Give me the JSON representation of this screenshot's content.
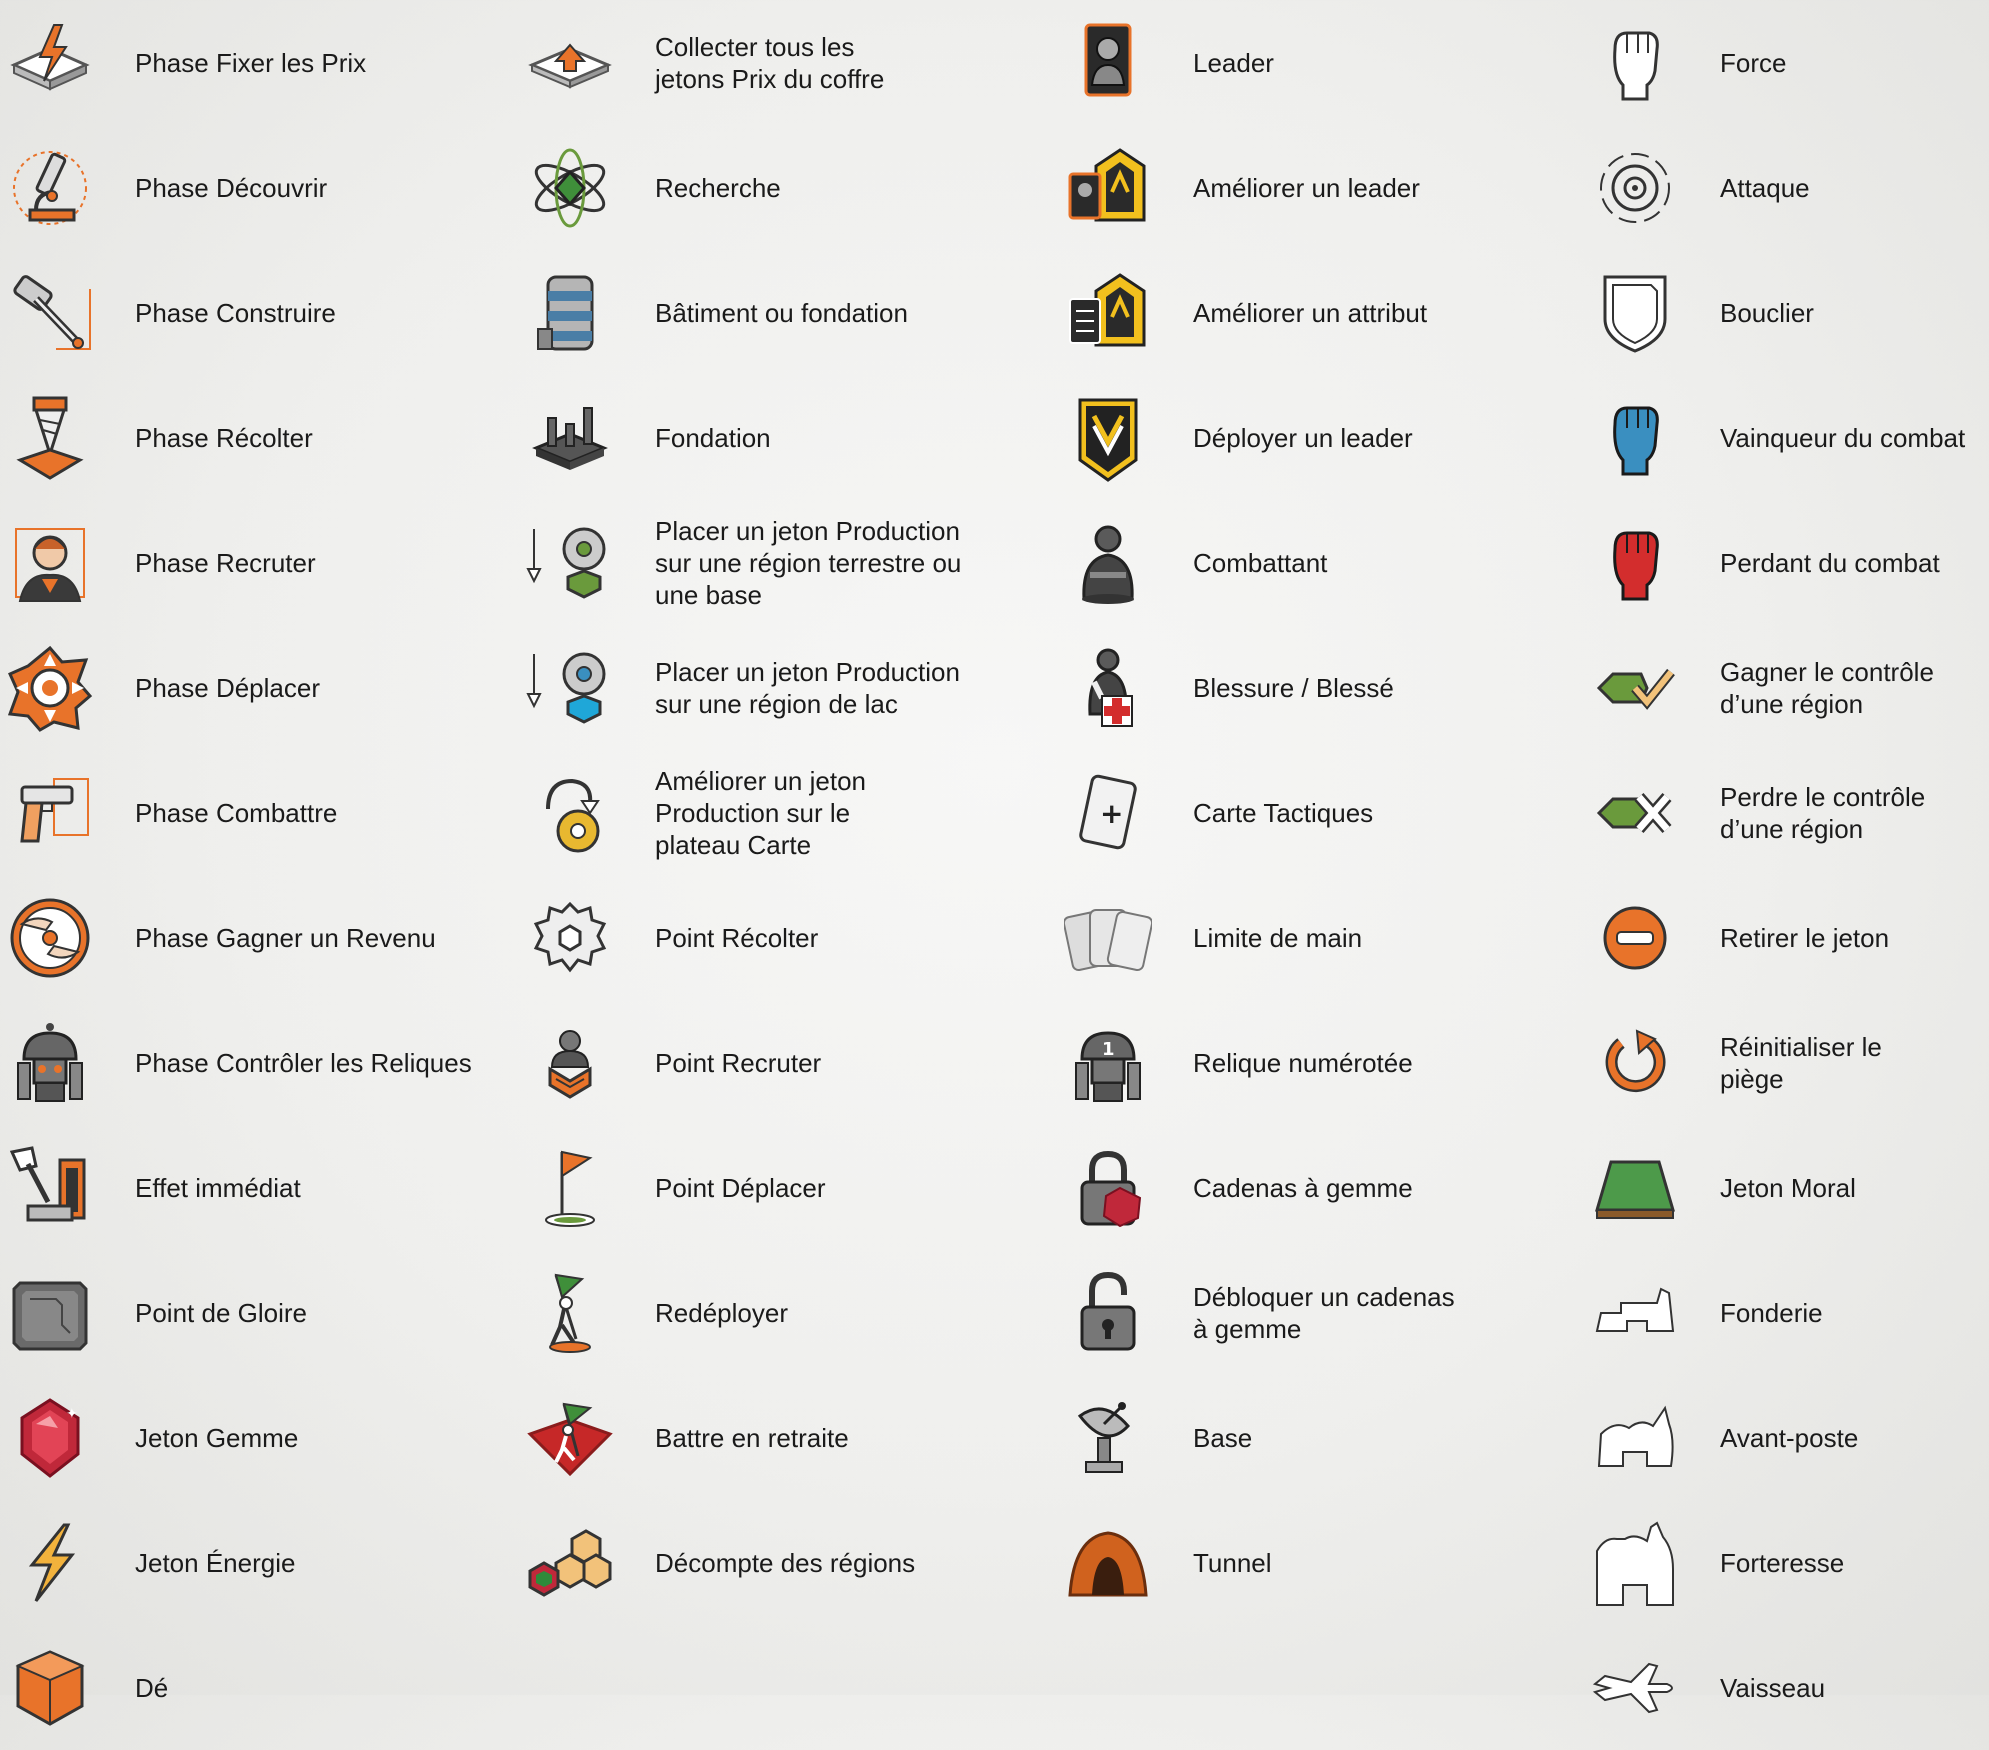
{
  "columns": [
    {
      "items": [
        {
          "label": "Phase Fixer les Prix",
          "icon": "price-phase-icon"
        },
        {
          "label": "Phase Découvrir",
          "icon": "microscope-icon"
        },
        {
          "label": "Phase Construire",
          "icon": "hammer-icon"
        },
        {
          "label": "Phase Récolter",
          "icon": "drill-icon"
        },
        {
          "label": "Phase Recruter",
          "icon": "recruit-portrait-icon"
        },
        {
          "label": "Phase Déplacer",
          "icon": "move-arrows-icon"
        },
        {
          "label": "Phase Combattre",
          "icon": "gun-icon"
        },
        {
          "label": "Phase Gagner un Revenu",
          "icon": "income-hands-icon"
        },
        {
          "label": "Phase Contrôler les Reliques",
          "icon": "relic-robot-icon"
        },
        {
          "label": "Effet immédiat",
          "icon": "lever-icon"
        },
        {
          "label": "Point de Gloire",
          "icon": "glory-chip-icon"
        },
        {
          "label": "Jeton Gemme",
          "icon": "gem-icon"
        },
        {
          "label": "Jeton Énergie",
          "icon": "energy-bolt-icon"
        },
        {
          "label": "Dé",
          "icon": "die-icon"
        }
      ]
    },
    {
      "items": [
        {
          "label": "Collecter tous les\njetons Prix du coffre",
          "icon": "collect-arrow-icon"
        },
        {
          "label": "Recherche",
          "icon": "atom-icon"
        },
        {
          "label": "Bâtiment ou fondation",
          "icon": "building-icon"
        },
        {
          "label": "Fondation",
          "icon": "foundation-icon"
        },
        {
          "label": "Placer un jeton Production\nsur une région terrestre ou\nune base",
          "icon": "production-green-icon"
        },
        {
          "label": "Placer un jeton Production\nsur une région de lac",
          "icon": "production-blue-icon"
        },
        {
          "label": "Améliorer un jeton\nProduction sur le\nplateau Carte",
          "icon": "upgrade-production-icon"
        },
        {
          "label": "Point Récolter",
          "icon": "gear-icon"
        },
        {
          "label": "Point Recruter",
          "icon": "recruit-point-icon"
        },
        {
          "label": "Point Déplacer",
          "icon": "flag-icon"
        },
        {
          "label": "Redéployer",
          "icon": "redeploy-icon"
        },
        {
          "label": "Battre en retraite",
          "icon": "retreat-icon"
        },
        {
          "label": "Décompte des régions",
          "icon": "hex-regions-icon"
        }
      ]
    },
    {
      "items": [
        {
          "label": "Leader",
          "icon": "leader-card-icon"
        },
        {
          "label": "Améliorer un leader",
          "icon": "upgrade-leader-icon"
        },
        {
          "label": "Améliorer un attribut",
          "icon": "upgrade-attribute-icon"
        },
        {
          "label": "Déployer un leader",
          "icon": "deploy-leader-icon"
        },
        {
          "label": "Combattant",
          "icon": "fighter-icon"
        },
        {
          "label": "Blessure / Blessé",
          "icon": "wounded-icon"
        },
        {
          "label": "Carte Tactiques",
          "icon": "tactics-card-icon"
        },
        {
          "label": "Limite de main",
          "icon": "hand-limit-icon"
        },
        {
          "label": "Relique numérotée",
          "icon": "numbered-relic-icon"
        },
        {
          "label": "Cadenas à gemme",
          "icon": "gem-lock-icon"
        },
        {
          "label": "Débloquer un cadenas\nà gemme",
          "icon": "unlock-icon"
        },
        {
          "label": "Base",
          "icon": "satellite-dish-icon"
        },
        {
          "label": "Tunnel",
          "icon": "tunnel-icon"
        }
      ]
    },
    {
      "items": [
        {
          "label": "Force",
          "icon": "fist-outline-icon"
        },
        {
          "label": "Attaque",
          "icon": "target-icon"
        },
        {
          "label": "Bouclier",
          "icon": "shield-icon"
        },
        {
          "label": "Vainqueur du combat",
          "icon": "blue-fist-icon"
        },
        {
          "label": "Perdant du combat",
          "icon": "red-fist-icon"
        },
        {
          "label": "Gagner le contrôle\nd’une région",
          "icon": "gain-control-icon"
        },
        {
          "label": "Perdre le contrôle\nd’une région",
          "icon": "lose-control-icon"
        },
        {
          "label": "Retirer le jeton",
          "icon": "remove-token-icon"
        },
        {
          "label": "Réinitialiser le\npiège",
          "icon": "reset-trap-icon"
        },
        {
          "label": "Jeton Moral",
          "icon": "morale-token-icon"
        },
        {
          "label": "Fonderie",
          "icon": "foundry-icon"
        },
        {
          "label": "Avant-poste",
          "icon": "outpost-icon"
        },
        {
          "label": "Forteresse",
          "icon": "fortress-icon"
        },
        {
          "label": "Vaisseau",
          "icon": "ship-icon"
        }
      ]
    }
  ],
  "colors": {
    "accent_orange": "#e8732a",
    "text": "#1a1a1a",
    "dark_grey": "#4a4a4a",
    "green": "#6a9a3c",
    "blue": "#3a8fc0",
    "red": "#d32d2d"
  }
}
